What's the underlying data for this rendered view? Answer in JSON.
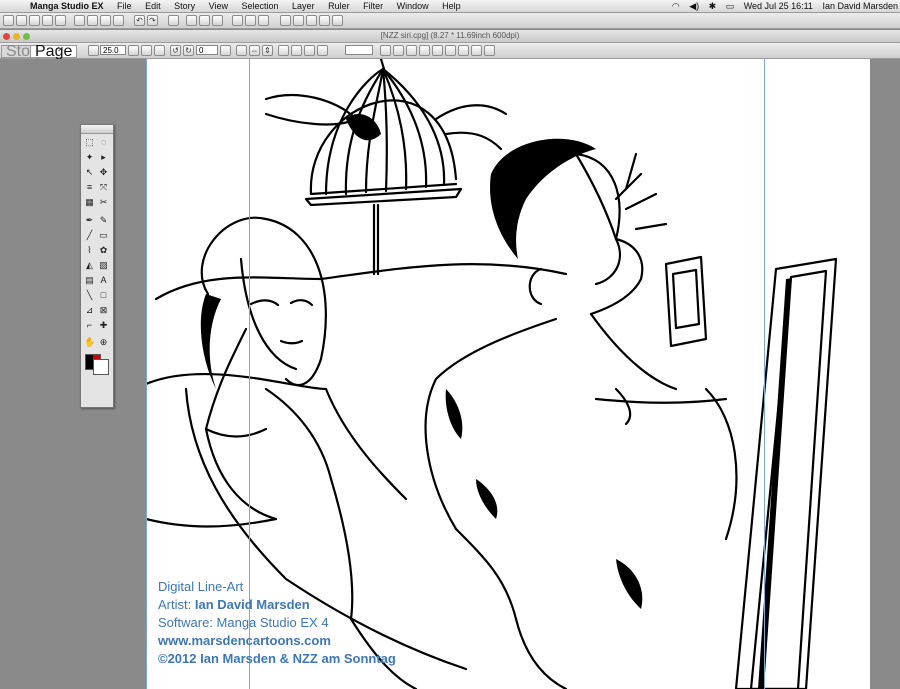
{
  "menubar": {
    "app_name": "Manga Studio EX",
    "menus": [
      "File",
      "Edit",
      "Story",
      "View",
      "Selection",
      "Layer",
      "Ruler",
      "Filter",
      "Window",
      "Help"
    ],
    "clock": "Wed Jul 25  16:11",
    "user": "Ian David Marsden",
    "icons": [
      "apple-icon",
      "wifi-icon",
      "volume-icon",
      "bluetooth-icon",
      "battery-icon",
      "spotlight-icon"
    ]
  },
  "document": {
    "title": "[NZZ siri.cpg] (8.27 * 11.69inch 600dpi)",
    "tabs": [
      "Story",
      "Page"
    ],
    "zoom": "25.0",
    "rotation": "0"
  },
  "credit": {
    "line1": "Digital Line-Art",
    "artist_label": "Artist:",
    "artist_name": "Ian David Marsden",
    "software": "Software: Manga Studio EX 4",
    "website": "www.marsdencartoons.com",
    "copyright": "©2012 Ian Marsden & NZZ am Sonntag"
  },
  "colors": {
    "credit_text": "#3c78b5",
    "guide": "#7fa7d6"
  }
}
